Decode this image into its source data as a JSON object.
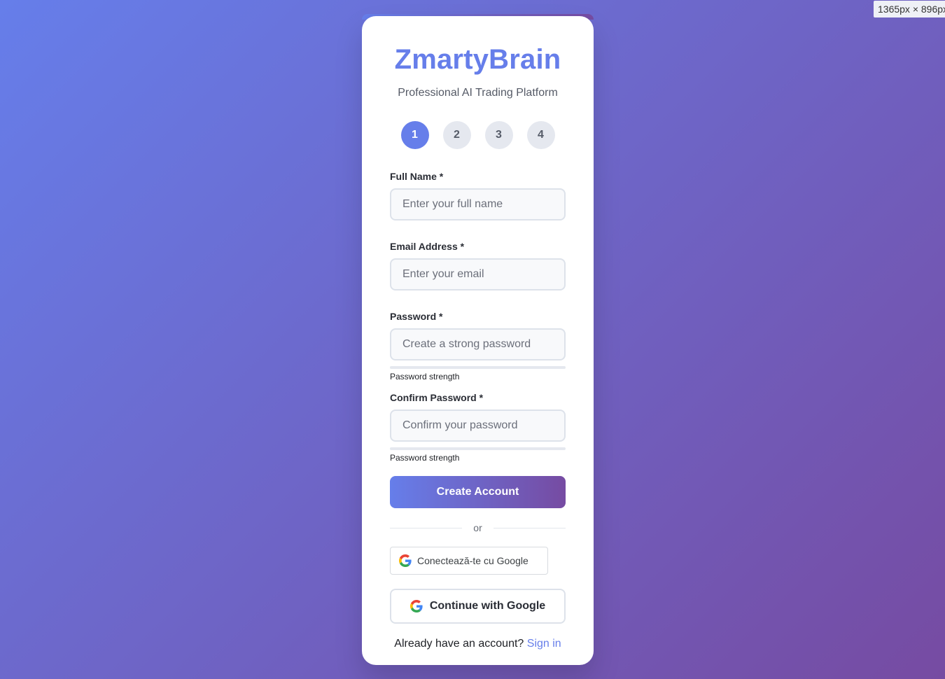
{
  "viewport_badge": "1365px × 896px",
  "brand": {
    "title": "ZmartyBrain",
    "tagline": "Professional AI Trading Platform"
  },
  "steps": [
    {
      "label": "1",
      "active": true
    },
    {
      "label": "2",
      "active": false
    },
    {
      "label": "3",
      "active": false
    },
    {
      "label": "4",
      "active": false
    }
  ],
  "form": {
    "full_name": {
      "label": "Full Name *",
      "placeholder": "Enter your full name",
      "value": ""
    },
    "email": {
      "label": "Email Address *",
      "placeholder": "Enter your email",
      "value": ""
    },
    "password": {
      "label": "Password *",
      "placeholder": "Create a strong password",
      "value": "",
      "strength_text": "Password strength"
    },
    "confirm_password": {
      "label": "Confirm Password *",
      "placeholder": "Confirm your password",
      "value": "",
      "strength_text": "Password strength"
    },
    "submit_label": "Create Account"
  },
  "divider_text": "or",
  "google_small_label": "Conectează-te cu Google",
  "google_big_label": "Continue with Google",
  "signin": {
    "prompt": "Already have an account?",
    "link": "Sign in"
  },
  "colors": {
    "accent": "#667eea",
    "gradient_end": "#764ba2"
  },
  "icons": {
    "google": "google-g-icon"
  }
}
